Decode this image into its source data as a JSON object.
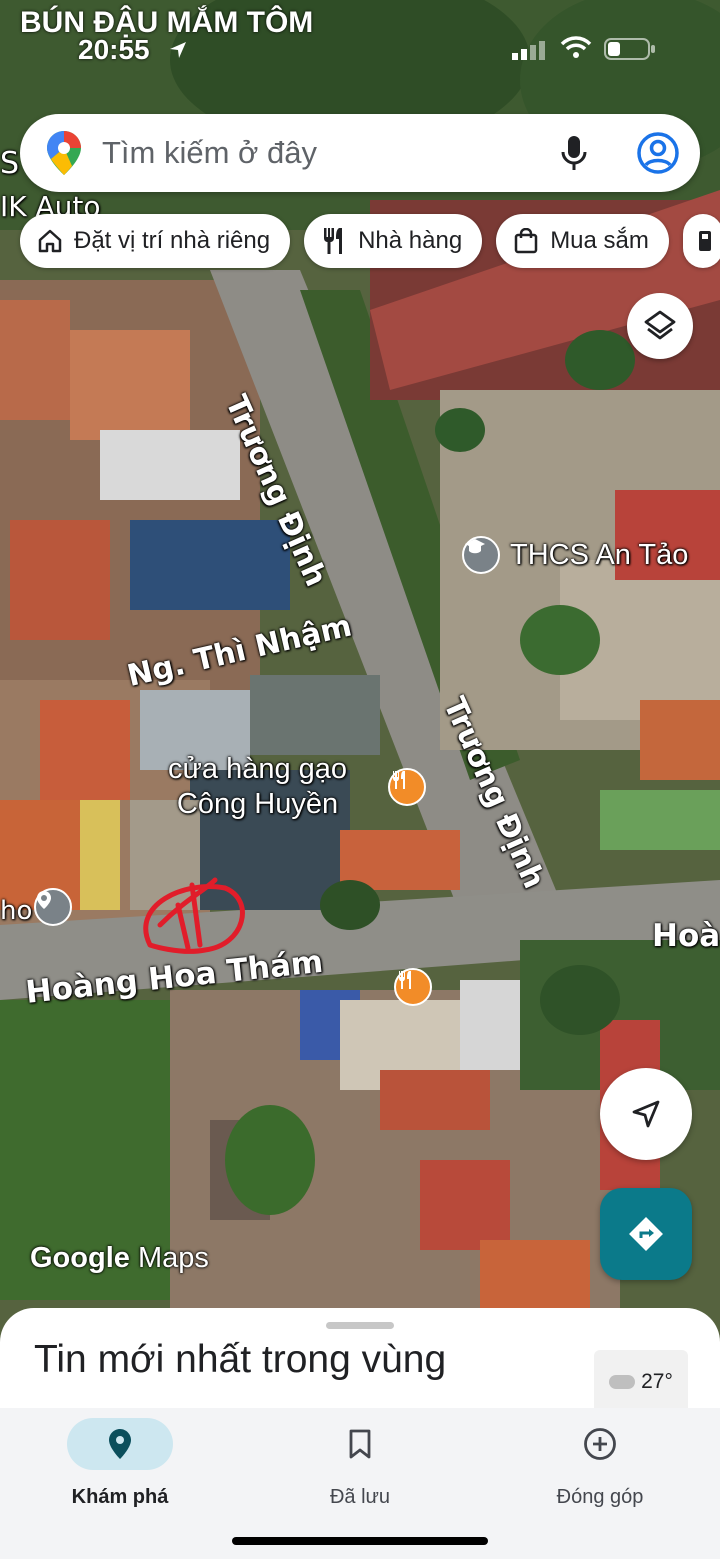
{
  "status": {
    "app_name": "BÚN ĐẬU MẮM TÔM",
    "time": "20:55"
  },
  "search": {
    "placeholder": "Tìm kiếm ở đây",
    "logo_icon": "maps-pin-icon",
    "mic_icon": "mic-icon",
    "account_icon": "account-icon"
  },
  "chips": [
    {
      "label": "Đặt vị trí nhà riêng",
      "icon": "home-icon"
    },
    {
      "label": "Nhà hàng",
      "icon": "restaurant-icon"
    },
    {
      "label": "Mua sắm",
      "icon": "shopping-bag-icon"
    }
  ],
  "map": {
    "streets": [
      "Trương Định",
      "Trương Định",
      "Ng. Thì Nhậm",
      "Hoàng Hoa Thám",
      "Hoà"
    ],
    "pois": [
      {
        "name": "THCS An Tảo",
        "type": "school"
      },
      {
        "name_line1": "cửa hàng gạo",
        "name_line2": "Công Huyền",
        "type": "restaurant"
      }
    ],
    "edge_labels": [
      "S",
      "IK Auto",
      "ho"
    ],
    "watermark_google": "Google",
    "watermark_maps": "Maps"
  },
  "sheet": {
    "title": "Tin mới nhất trong vùng",
    "weather_temp": "27°"
  },
  "nav": [
    {
      "label": "Khám phá",
      "icon": "explore-pin-icon",
      "active": true
    },
    {
      "label": "Đã lưu",
      "icon": "bookmark-icon",
      "active": false
    },
    {
      "label": "Đóng góp",
      "icon": "add-circle-icon",
      "active": false
    }
  ],
  "colors": {
    "teal": "#0b7a8a",
    "nav_active": "#cde7f0",
    "poi_orange": "#f28c28",
    "poi_gray": "#7a8288"
  }
}
